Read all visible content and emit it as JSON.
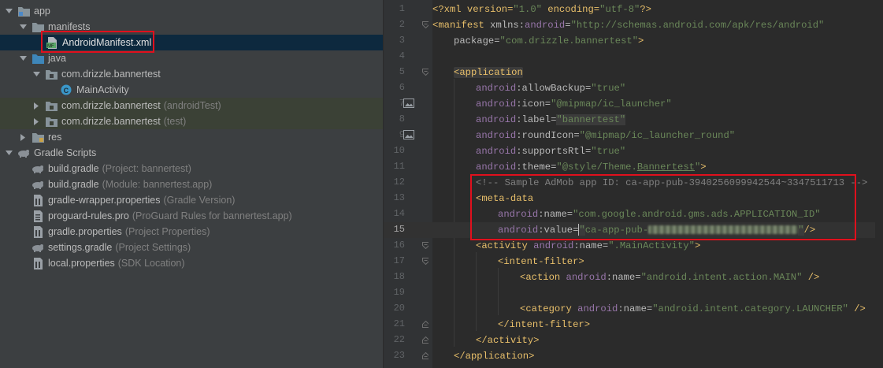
{
  "tree": {
    "items": [
      {
        "label": "app",
        "hint": ""
      },
      {
        "label": "manifests",
        "hint": ""
      },
      {
        "label": "AndroidManifest.xml",
        "hint": ""
      },
      {
        "label": "java",
        "hint": ""
      },
      {
        "label": "com.drizzle.bannertest",
        "hint": ""
      },
      {
        "label": "MainActivity",
        "hint": ""
      },
      {
        "label": "com.drizzle.bannertest",
        "hint": "(androidTest)"
      },
      {
        "label": "com.drizzle.bannertest",
        "hint": "(test)"
      },
      {
        "label": "res",
        "hint": ""
      },
      {
        "label": "Gradle Scripts",
        "hint": ""
      },
      {
        "label": "build.gradle",
        "hint": "(Project: bannertest)"
      },
      {
        "label": "build.gradle",
        "hint": "(Module: bannertest.app)"
      },
      {
        "label": "gradle-wrapper.properties",
        "hint": "(Gradle Version)"
      },
      {
        "label": "proguard-rules.pro",
        "hint": "(ProGuard Rules for bannertest.app)"
      },
      {
        "label": "gradle.properties",
        "hint": "(Project Properties)"
      },
      {
        "label": "settings.gradle",
        "hint": "(Project Settings)"
      },
      {
        "label": "local.properties",
        "hint": "(SDK Location)"
      }
    ]
  },
  "editor": {
    "line_numbers": [
      "1",
      "2",
      "3",
      "4",
      "5",
      "6",
      "7",
      "8",
      "9",
      "10",
      "11",
      "12",
      "13",
      "14",
      "15",
      "16",
      "17",
      "18",
      "19",
      "20",
      "21",
      "22",
      "23"
    ],
    "current_line": "15",
    "code": {
      "l1a": "<?xml version=",
      "l1b": "\"1.0\"",
      "l1c": " encoding=",
      "l1d": "\"utf-8\"",
      "l1e": "?>",
      "l2a": "<manifest",
      "l2b": " xmlns:",
      "l2c": "android",
      "l2d": "=",
      "l2e": "\"http://schemas.android.com/apk/res/android\"",
      "l3a": "package=",
      "l3b": "\"com.drizzle.bannertest\"",
      "l3c": ">",
      "l5a": "<application",
      "l6a": "android",
      "l6b": ":allowBackup=",
      "l6c": "\"true\"",
      "l7a": "android",
      "l7b": ":icon=",
      "l7c": "\"@mipmap/ic_launcher\"",
      "l8a": "android",
      "l8b": ":label=",
      "l8c": "\"bannertest\"",
      "l9a": "android",
      "l9b": ":roundIcon=",
      "l9c": "\"@mipmap/ic_launcher_round\"",
      "l10a": "android",
      "l10b": ":supportsRtl=",
      "l10c": "\"true\"",
      "l11a": "android",
      "l11b": ":theme=",
      "l11c": "\"@style/Theme.",
      "l11d": "Bannertest",
      "l11e": "\"",
      "l11f": ">",
      "l12a": "<!-- Sample AdMob app ID: ca-app-pub-3940256099942544~3347511713 -->",
      "l13a": "<meta-data",
      "l14a": "android",
      "l14b": ":name=",
      "l14c": "\"com.google.android.gms.ads.APPLICATION_ID\"",
      "l15a": "android",
      "l15b": ":value=",
      "l15c": "\"",
      "l15d": "ca-app-pub-",
      "l15e": "\"",
      "l15f": "/>",
      "l16a": "<activity",
      "l16b": " android",
      "l16c": ":name=",
      "l16d": "\".MainActivity\"",
      "l16e": ">",
      "l17a": "<intent-filter>",
      "l18a": "<action",
      "l18b": " android",
      "l18c": ":name=",
      "l18d": "\"android.intent.action.MAIN\"",
      "l18e": " />",
      "l20a": "<category",
      "l20b": " android",
      "l20c": ":name=",
      "l20d": "\"android.intent.category.LAUNCHER\"",
      "l20e": " />",
      "l21a": "</intent-filter>",
      "l22a": "</activity>",
      "l23a": "</application>"
    }
  },
  "colors": {
    "highlight_box": "#e0101d",
    "tag": "#e8bf6a",
    "string": "#6a8759",
    "namespace": "#9876aa",
    "comment": "#808080"
  }
}
